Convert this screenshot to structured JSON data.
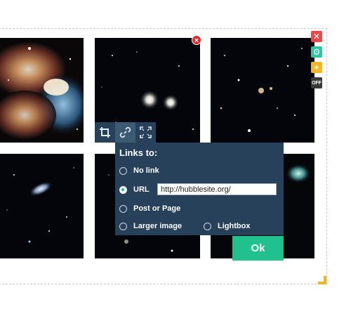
{
  "gallery": {
    "images": [
      {
        "name": "butterfly-nebula"
      },
      {
        "name": "galaxy-pair"
      },
      {
        "name": "star-field"
      },
      {
        "name": "comet-galaxy"
      },
      {
        "name": "deep-field"
      },
      {
        "name": "nebula-fragment"
      }
    ],
    "remove_icon": "close-icon",
    "side_tools": {
      "close_icon": "close-icon",
      "settings_icon": "gear-icon",
      "add_icon": "plus-icon",
      "toggle_label": "OFF"
    }
  },
  "image_toolbar": {
    "crop_icon": "crop-icon",
    "link_icon": "link-icon",
    "fullscreen_icon": "fullscreen-icon"
  },
  "link_panel": {
    "title": "Links to:",
    "options": {
      "no_link": "No link",
      "url": "URL",
      "post_or_page": "Post or Page",
      "larger_image": "Larger image",
      "lightbox": "Lightbox"
    },
    "selected": "url",
    "url_value": "http://hubblesite.org/"
  },
  "ok_button": "Ok",
  "colors": {
    "panel": "#264159",
    "accent": "#21c18d",
    "remove": "#d92b2b",
    "gear": "#2fc4a3",
    "add": "#f2b824"
  }
}
